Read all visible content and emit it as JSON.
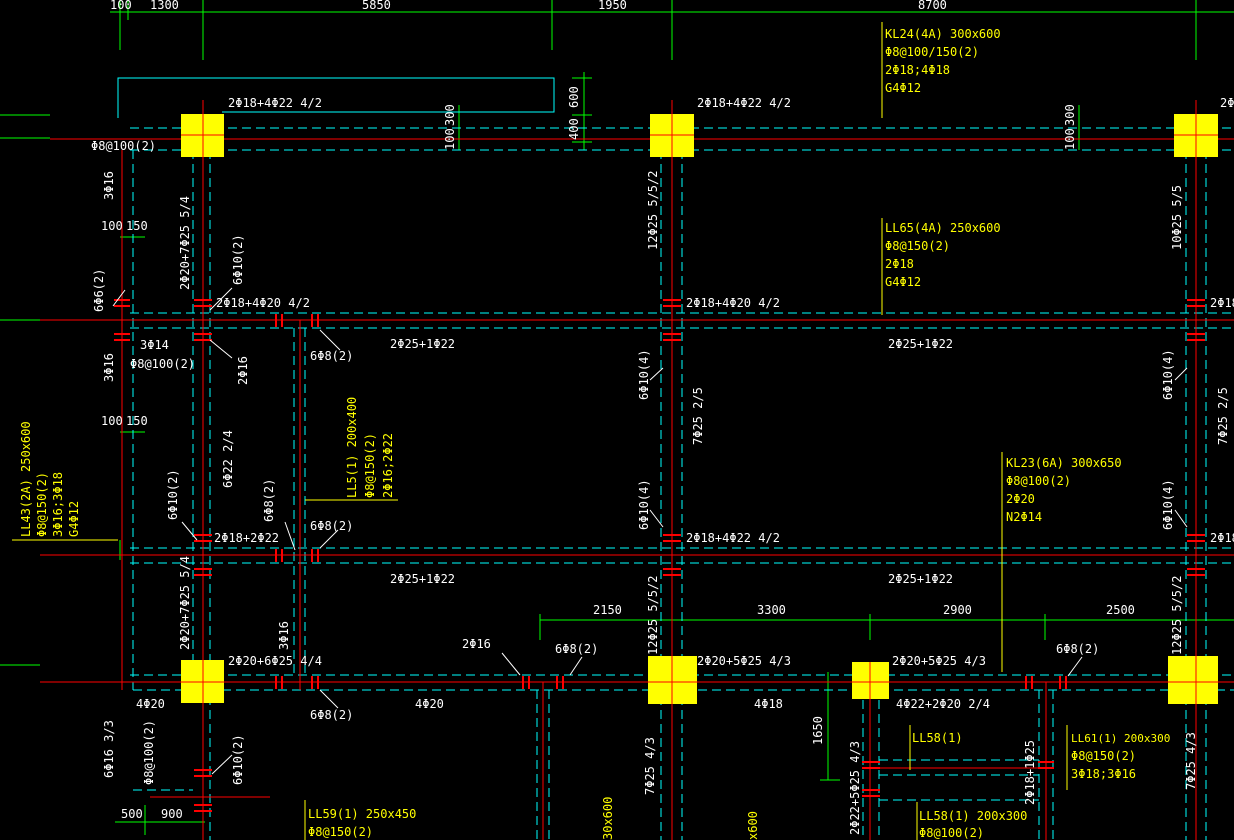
{
  "colors": {
    "background": "#000000",
    "beam_red": "#ff0000",
    "beam_cyan": "#00ffff",
    "dim_green": "#00ff00",
    "column_yellow": "#ffff00",
    "text_white": "#ffffff",
    "text_yellow": "#ffff00"
  },
  "dimensions": {
    "top": [
      "100",
      "1300",
      "5850",
      "1950",
      "8700"
    ],
    "mid": [
      "2150",
      "3300",
      "2900",
      "2500"
    ],
    "left": [
      "100",
      "150",
      "100",
      "150"
    ],
    "bottom": [
      "500",
      "900"
    ],
    "v600": "600",
    "v400": "400",
    "v100a": "100",
    "v300a": "300",
    "v100b": "100",
    "v300b": "300",
    "v1650": "1650"
  },
  "annotations": {
    "kl24": [
      "KL24(4A) 300x600",
      "Φ8@100/150(2)",
      "2Φ18;4Φ18",
      "G4Φ12"
    ],
    "ll65": [
      "LL65(4A) 250x600",
      "Φ8@150(2)",
      "2Φ18",
      "G4Φ12"
    ],
    "kl23": [
      "KL23(6A) 300x650",
      "Φ8@100(2)",
      "2Φ20",
      "N2Φ14"
    ],
    "ll5": [
      "LL5(1) 200x400",
      "Φ8@150(2)",
      "2Φ16;2Φ22"
    ],
    "ll43": [
      "LL43(2A) 250x600",
      "Φ8@150(2)",
      "3Φ16;3Φ18",
      "G4Φ12"
    ],
    "ll61": [
      "LL61(1) 200x300",
      "Φ8@150(2)",
      "3Φ18;3Φ16"
    ],
    "ll58a": "LL58(1)",
    "ll58b": [
      "LL58(1) 200x300",
      "Φ8@100(2)"
    ],
    "ll59": [
      "LL59(1) 250x450",
      "Φ8@150(2)"
    ]
  },
  "rebar_labels": {
    "r1": "2Φ18+4Φ22 4/2",
    "r2": "2Φ18+4Φ22 4/2",
    "r3": "2Φ18",
    "r4": "Φ8@100(2)",
    "r5": "2Φ18+4Φ20 4/2",
    "r6": "2Φ18+4Φ20 4/2",
    "r7": "2Φ18",
    "r8": "2Φ25+1Φ22",
    "r9": "2Φ25+1Φ22",
    "r10": "6Φ8(2)",
    "r11": "3Φ14",
    "r12": "Φ8@100(2)",
    "r13": "2Φ18+2Φ22",
    "r14": "2Φ18+4Φ22 4/2",
    "r15": "2Φ18",
    "r16": "6Φ8(2)",
    "r17": "2Φ25+1Φ22",
    "r18": "2Φ25+1Φ22",
    "r19": "2Φ20+6Φ25 4/4",
    "r20": "2Φ20+5Φ25 4/3",
    "r21": "2Φ20+5Φ25 4/3",
    "r22": "4Φ20",
    "r23": "4Φ20",
    "r24": "4Φ18",
    "r25": "4Φ22+2Φ20 2/4",
    "r26": "2Φ16",
    "r27": "6Φ8(2)",
    "r28": "6Φ8(2)",
    "r29": "6Φ8(2)",
    "v1": "3Φ16",
    "v2": "2Φ20+7Φ25 5/4",
    "v3": "6Φ10(2)",
    "v4": "6Φ6(2)",
    "v5": "3Φ16",
    "v6": "2Φ16",
    "v7": "6Φ22 2/4",
    "v8": "6Φ10(2)",
    "v9": "6Φ8(2)",
    "v10": "2Φ20+7Φ25 5/4",
    "v11": "3Φ16",
    "v12": "12Φ25 5/5/2",
    "v13": "6Φ10(4)",
    "v14": "7Φ25 2/5",
    "v15": "6Φ10(4)",
    "v16": "12Φ25 5/5/2",
    "v17": "7Φ25 4/3",
    "v18": "10Φ25 5/5",
    "v19": "6Φ10(4)",
    "v20": "7Φ25 2/5",
    "v21": "6Φ10(4)",
    "v22": "12Φ25 5/5/2",
    "v23": "7Φ25 4/3",
    "v24": "6Φ16 3/3",
    "v25": "Φ8@100(2)",
    "v26": "6Φ10(2)",
    "v27": "2Φ22+5Φ25 4/3",
    "v28": "2Φ18+1Φ25",
    "v29": "30x600",
    "v30": "x600"
  }
}
